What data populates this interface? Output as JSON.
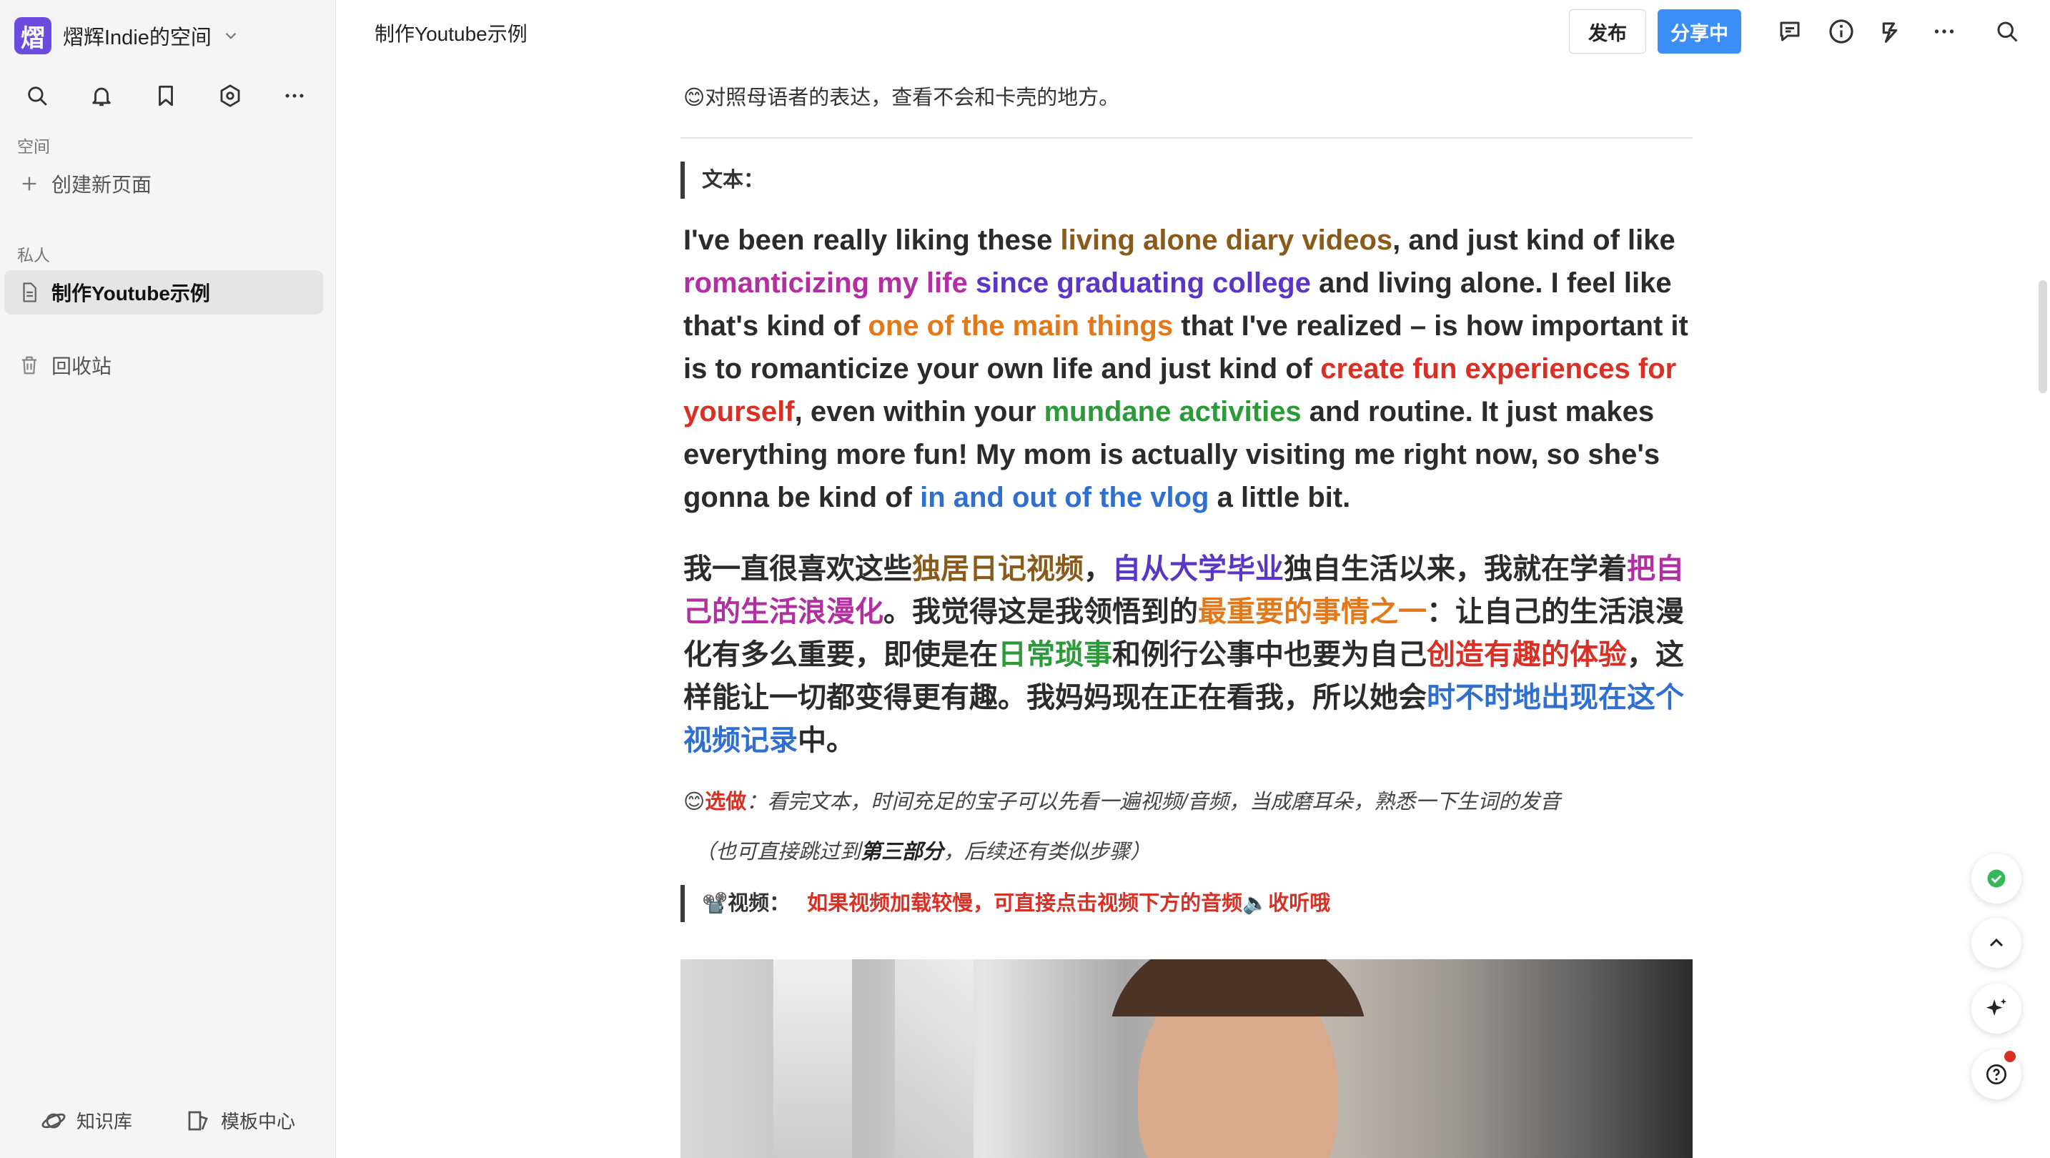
{
  "workspace": {
    "logo_char": "熠",
    "name": "熠辉Indie的空间"
  },
  "sidebar": {
    "section_space": "空间",
    "create_page": "创建新页面",
    "section_private": "私人",
    "pages": [
      {
        "label": "制作Youtube示例",
        "active": true
      }
    ],
    "trash": "回收站",
    "bottom": {
      "knowledge": "知识库",
      "templates": "模板中心"
    }
  },
  "header": {
    "doc_title": "制作Youtube示例",
    "publish": "发布",
    "share": "分享中"
  },
  "content": {
    "note_top": "😊对照母语者的表达，查看不会和卡壳的地方。",
    "text_heading": "文本：",
    "en_paragraph": [
      {
        "t": "I've been really liking these "
      },
      {
        "t": "living alone diary videos",
        "c": "c-brown"
      },
      {
        "t": ", and just kind of like "
      },
      {
        "t": "romanticizing my life",
        "c": "c-purple"
      },
      {
        "t": " "
      },
      {
        "t": "since graduating college",
        "c": "c-violet"
      },
      {
        "t": " and living alone. I feel like that's kind of "
      },
      {
        "t": "one of the main things",
        "c": "c-orange"
      },
      {
        "t": " that I've realized – is how important it is to romanticize your own life and just kind of "
      },
      {
        "t": "create fun experiences for yourself",
        "c": "c-red"
      },
      {
        "t": ", even within your "
      },
      {
        "t": "mundane activities",
        "c": "c-green"
      },
      {
        "t": " and routine. It just makes everything more fun! My mom is actually visiting me right now, so she's gonna be kind of "
      },
      {
        "t": "in and out of the vlog",
        "c": "c-blue"
      },
      {
        "t": " a little bit."
      }
    ],
    "zh_paragraph": [
      {
        "t": "我一直很喜欢这些"
      },
      {
        "t": "独居日记视频",
        "c": "c-brown"
      },
      {
        "t": "，"
      },
      {
        "t": "自从大学毕业",
        "c": "c-violet"
      },
      {
        "t": "独自生活以来，我就在学着"
      },
      {
        "t": "把自己的生活浪漫化",
        "c": "c-purple"
      },
      {
        "t": "。我觉得这是我领悟到的"
      },
      {
        "t": "最重要的事情之一",
        "c": "c-orange"
      },
      {
        "t": "：让自己的生活浪漫化有多么重要，即使是在"
      },
      {
        "t": "日常琐事",
        "c": "c-green"
      },
      {
        "t": "和例行公事中也要为自己"
      },
      {
        "t": "创造有趣的体验",
        "c": "c-red"
      },
      {
        "t": "，这样能让一切都变得更有趣。我妈妈现在正在看我，所以她会"
      },
      {
        "t": "时不时地出现在这个视频记录",
        "c": "c-blue"
      },
      {
        "t": "中。"
      }
    ],
    "optional_emoji": "😊",
    "optional_tag": "选做",
    "optional_text": "：看完文本，时间充足的宝子可以先看一遍视频/音频，当成磨耳朵，熟悉一下生词的发音",
    "optional_note_pre": "（也可直接跳过到",
    "optional_note_bold": "第三部分",
    "optional_note_post": "，后续还有类似步骤）",
    "video_heading": "📽️视频：",
    "video_warning": "如果视频加载较慢，可直接点击视频下方的音频🔈收听哦"
  },
  "colors": {
    "accent": "#3a8ef6",
    "logo": "#6b4cdf",
    "warning": "#d93025"
  },
  "icons": [
    "search-icon",
    "bell-icon",
    "bookmark-icon",
    "settings-icon",
    "more-icon",
    "comment-icon",
    "info-icon",
    "flash-icon",
    "check-icon",
    "chevron-up-icon",
    "sparkle-icon",
    "help-icon"
  ]
}
